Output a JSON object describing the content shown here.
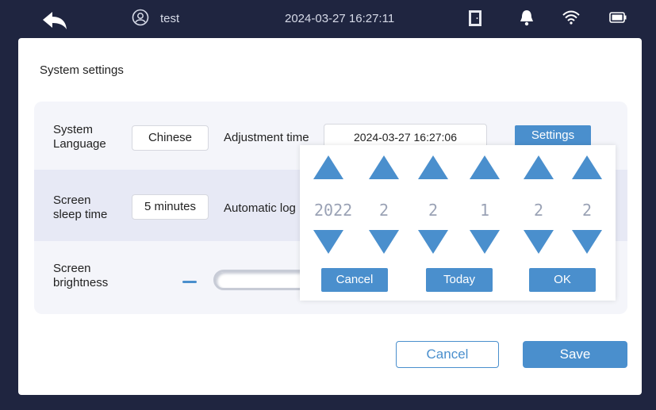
{
  "status_bar": {
    "user_name": "test",
    "datetime": "2024-03-27 16:27:11",
    "icons": [
      "back-arrow-icon",
      "user-icon",
      "door-icon",
      "bell-icon",
      "wifi-icon",
      "battery-icon"
    ]
  },
  "panel": {
    "title": "System settings",
    "rows": {
      "language": {
        "label_line1": "System",
        "label_line2": "Language",
        "value": "Chinese"
      },
      "adjust_time": {
        "label": "Adjustment time",
        "value": "2024-03-27 16:27:06",
        "button": "Settings"
      },
      "sleep": {
        "label_line1": "Screen",
        "label_line2": "sleep time",
        "value": "5 minutes"
      },
      "auto_logout": {
        "label": "Automatic log"
      },
      "brightness": {
        "label_line1": "Screen",
        "label_line2": "brightness"
      }
    }
  },
  "picker": {
    "digits": [
      "2022",
      "2",
      "2",
      "1",
      "2",
      "2"
    ],
    "cancel": "Cancel",
    "today": "Today",
    "ok": "OK"
  },
  "footer": {
    "cancel": "Cancel",
    "save": "Save"
  },
  "colors": {
    "accent": "#4a8fcd",
    "topbar": "#1f2540"
  }
}
